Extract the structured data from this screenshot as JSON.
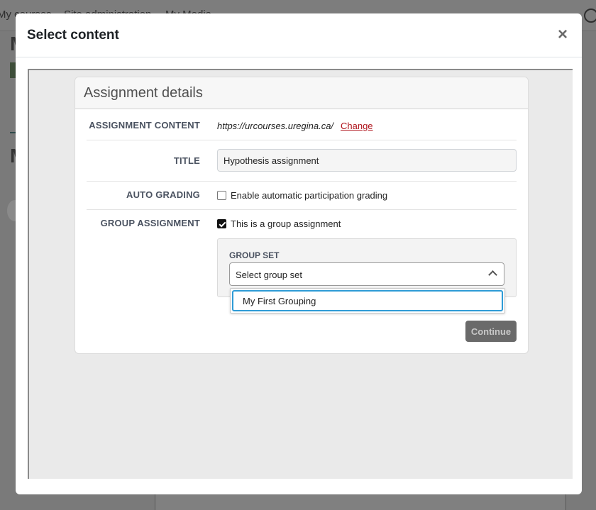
{
  "background": {
    "nav": [
      "My courses",
      "Site administration",
      "My Media"
    ]
  },
  "modal": {
    "title": "Select content",
    "close_glyph": "×"
  },
  "form": {
    "card_title": "Assignment details",
    "assignment_content": {
      "label": "ASSIGNMENT CONTENT",
      "url": "https://urcourses.uregina.ca/",
      "change_link": "Change"
    },
    "title": {
      "label": "TITLE",
      "value": "Hypothesis assignment"
    },
    "auto_grading": {
      "label": "AUTO GRADING",
      "checkbox_label": "Enable automatic participation grading",
      "checked": false
    },
    "group_assignment": {
      "label": "GROUP ASSIGNMENT",
      "checkbox_label": "This is a group assignment",
      "checked": true
    },
    "group_set": {
      "label": "GROUP SET",
      "selected": "Select group set",
      "options": [
        "My First Grouping"
      ]
    },
    "continue_button": "Continue"
  },
  "colors": {
    "link": "#b0141c",
    "focus_ring": "#2e9bd6",
    "disabled_button": "#6a6a6a"
  },
  "icons": {
    "close": "close-icon",
    "dropdown": "chevron-up-icon",
    "checkmark": "checkmark-icon"
  }
}
